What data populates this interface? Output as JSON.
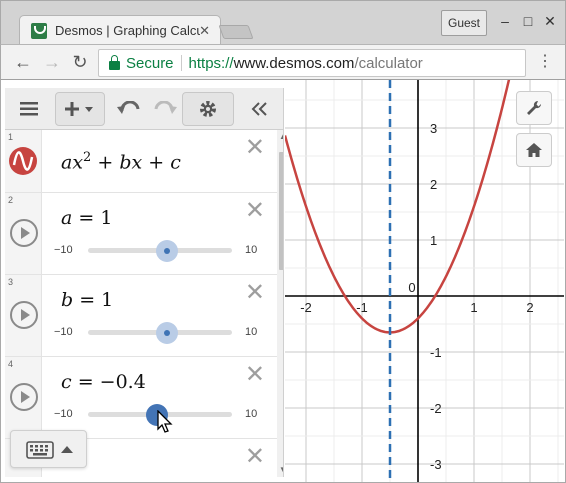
{
  "browser": {
    "tab_title": "Desmos | Graphing Calculator",
    "guest_label": "Guest",
    "secure_label": "Secure",
    "url_protocol": "https://",
    "url_host": "www.desmos.com",
    "url_path": "/calculator"
  },
  "expressions": [
    {
      "index": "1",
      "type": "formula",
      "color": "#c74440"
    },
    {
      "index": "2",
      "variable": "a",
      "value": "1",
      "min": "−10",
      "max": "10",
      "fraction": 0.55,
      "active": false
    },
    {
      "index": "3",
      "variable": "b",
      "value": "1",
      "min": "−10",
      "max": "10",
      "fraction": 0.55,
      "active": false
    },
    {
      "index": "4",
      "variable": "c",
      "value": "−0.4",
      "min": "−10",
      "max": "10",
      "fraction": 0.48,
      "active": true
    }
  ],
  "graph": {
    "x_range": [
      -2.4,
      2.4
    ],
    "y_range": [
      -3.4,
      3.4
    ],
    "x_ticks": [
      "-2",
      "-1",
      "0",
      "1",
      "2"
    ],
    "y_ticks": [
      "3",
      "2",
      "1",
      "-1",
      "-2",
      "-3"
    ],
    "curve_color": "#c74440",
    "axis_line_color": "#2d70b3",
    "parabola": {
      "a": 1,
      "b": 1,
      "c": -0.4
    },
    "vertical_line_x": -0.5
  }
}
